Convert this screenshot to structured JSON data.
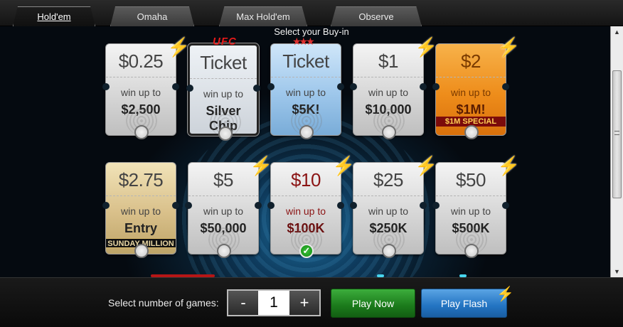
{
  "tabs": [
    {
      "label": "Hold'em",
      "active": true
    },
    {
      "label": "Omaha",
      "active": false
    },
    {
      "label": "Max Hold'em",
      "active": false
    },
    {
      "label": "Observe",
      "active": false
    }
  ],
  "buyin_title": "Select your Buy-in",
  "tickets": [
    {
      "price": "$0.25",
      "win_label": "win up to",
      "prize": "$2,500",
      "style": "silver",
      "fast": true,
      "selected": false
    },
    {
      "price": "Ticket",
      "win_label": "win up to",
      "prize": "Silver Chip",
      "style": "dark",
      "brand": "UFC",
      "fast": false,
      "selected": false
    },
    {
      "price": "Ticket",
      "win_label": "win up to",
      "prize": "$5K!",
      "style": "blue",
      "brand_icon": "stars",
      "fast": false,
      "selected": false
    },
    {
      "price": "$1",
      "win_label": "win up to",
      "prize": "$10,000",
      "style": "silver",
      "fast": true,
      "selected": false
    },
    {
      "price": "$2",
      "win_label": "win up to",
      "prize": "$1M!",
      "style": "orange",
      "ribbon": "$1M SPECIAL",
      "fast": true,
      "selected": false
    },
    {
      "price": "$2.75",
      "win_label": "win up to",
      "prize": "Entry",
      "style": "gold",
      "ribbon": "SUNDAY MILLION",
      "fast": false,
      "selected": false
    },
    {
      "price": "$5",
      "win_label": "win up to",
      "prize": "$50,000",
      "style": "silver",
      "fast": true,
      "selected": false
    },
    {
      "price": "$10",
      "win_label": "win up to",
      "prize": "$100K",
      "style": "red",
      "fast": true,
      "selected": true
    },
    {
      "price": "$25",
      "win_label": "win up to",
      "prize": "$250K",
      "style": "silver",
      "fast": true,
      "selected": false
    },
    {
      "price": "$50",
      "win_label": "win up to",
      "prize": "$500K",
      "style": "silver",
      "fast": true,
      "selected": false
    }
  ],
  "bottom": {
    "games_label": "Select number of games:",
    "minus": "-",
    "quantity": "1",
    "plus": "+",
    "play_now": "Play Now",
    "play_flash": "Play Flash"
  },
  "icons": {
    "fast": "lightning-bolt-icon",
    "selected": "checkmark-icon",
    "scroll_up": "arrow-up-icon",
    "scroll_down": "arrow-down-icon"
  },
  "colors": {
    "accent_blue": "#2374c2",
    "accent_green": "#1b7a1b",
    "bolt": "#48d6ef"
  }
}
